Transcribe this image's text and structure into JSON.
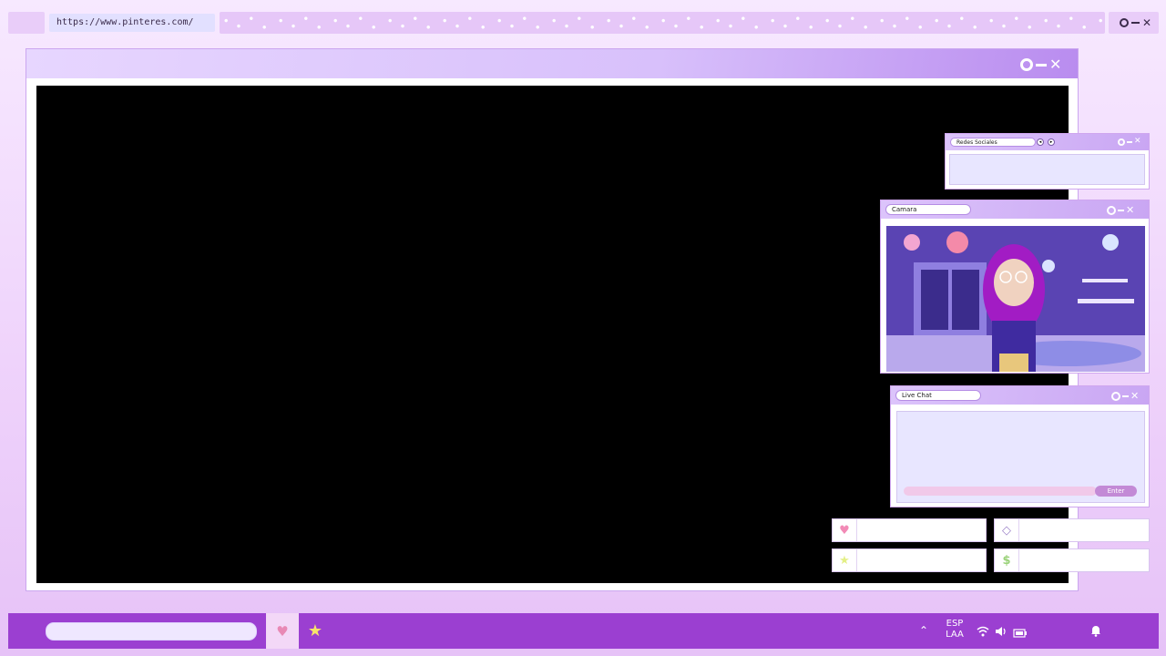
{
  "browser": {
    "url": "https://www.pinteres.com/"
  },
  "windows": {
    "social": {
      "label": "Redes Sociales"
    },
    "camera": {
      "label": "Camara"
    },
    "chat": {
      "label": "Live Chat",
      "enter_label": "Enter"
    }
  },
  "stats": [
    {
      "icon": "heart-icon"
    },
    {
      "icon": "diamond-icon"
    },
    {
      "icon": "star-icon"
    },
    {
      "icon": "dollar-icon"
    }
  ],
  "taskbar": {
    "language": "ESP",
    "region": "LAA"
  },
  "colors": {
    "accent": "#9b3fd1",
    "window_border": "#cba6ef",
    "title_gradient_end": "#b98cef"
  }
}
